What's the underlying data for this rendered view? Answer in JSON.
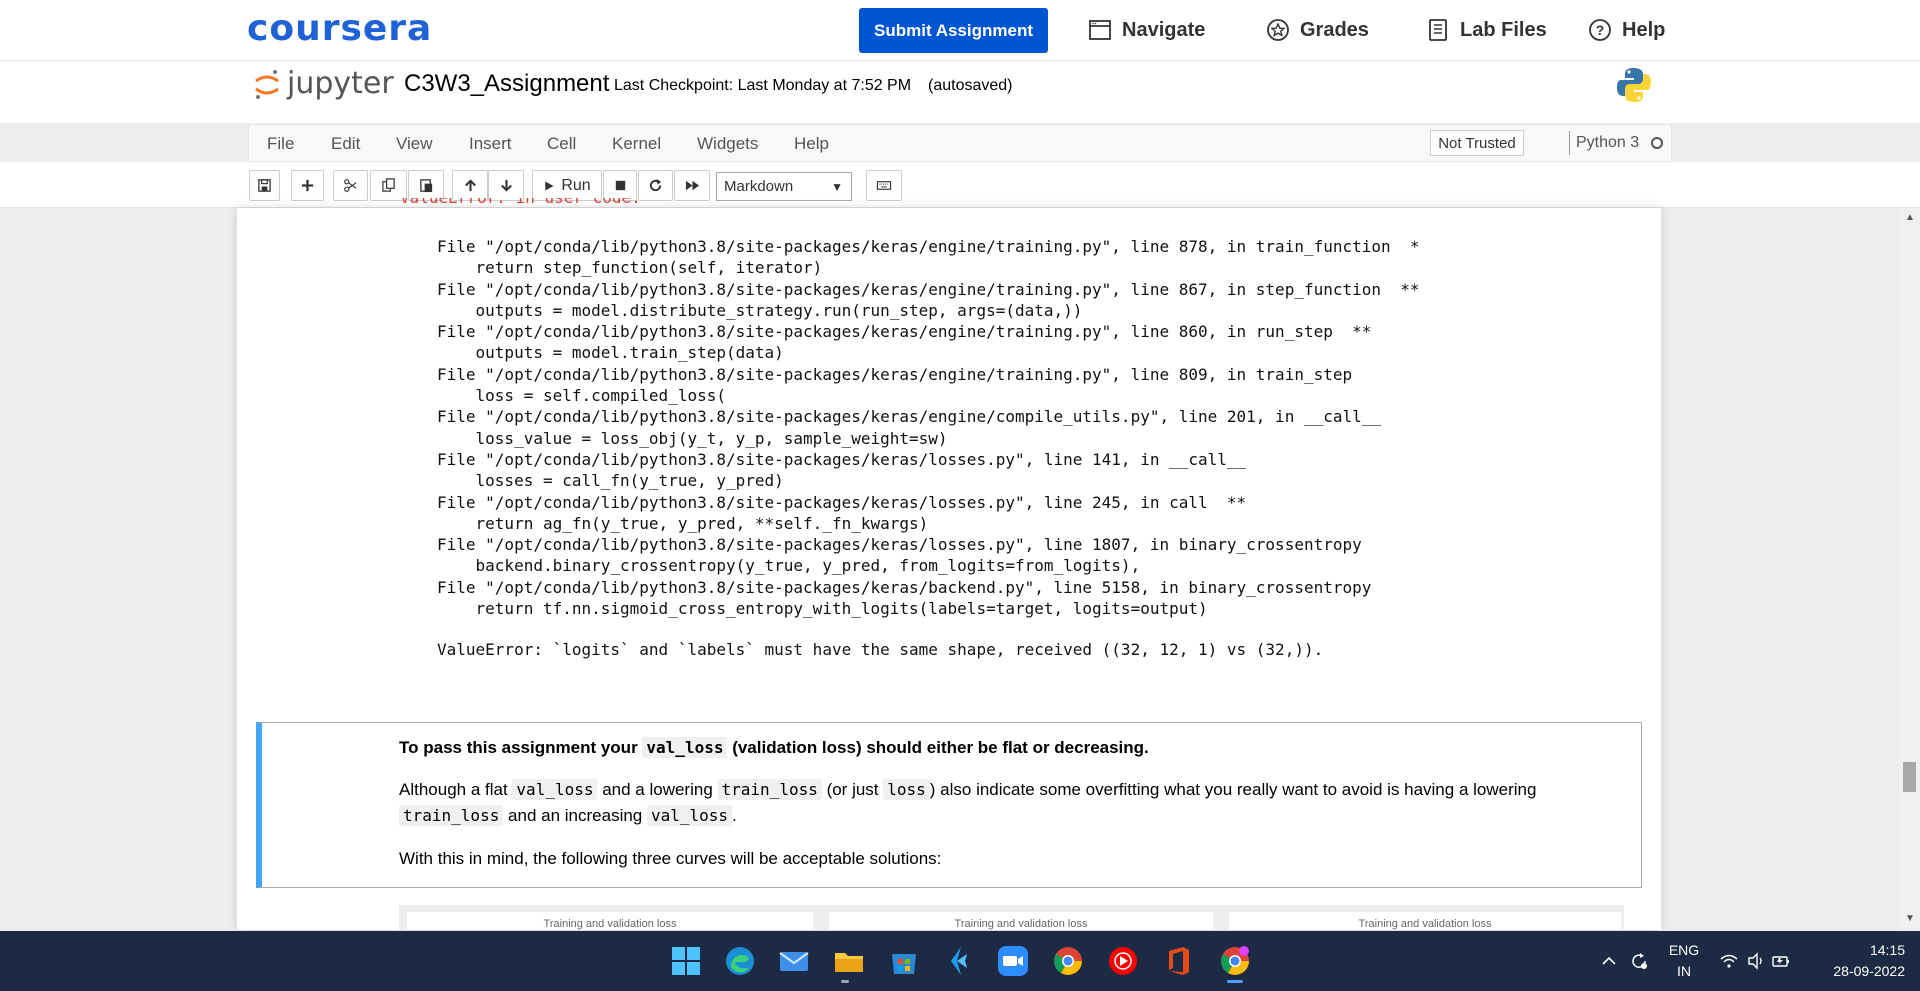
{
  "coursera": {
    "logo": "coursera",
    "submit_label": "Submit Assignment",
    "nav": [
      "Navigate",
      "Grades",
      "Lab Files",
      "Help"
    ]
  },
  "jupyter": {
    "logo_text": "jupyter",
    "notebook_title": "C3W3_Assignment",
    "checkpoint": "Last Checkpoint: Last Monday at 7:52 PM",
    "autosaved": "(autosaved)"
  },
  "menu": [
    "File",
    "Edit",
    "View",
    "Insert",
    "Cell",
    "Kernel",
    "Widgets",
    "Help"
  ],
  "trust_status": "Not Trusted",
  "kernel_name": "Python 3",
  "toolbar": {
    "run_label": "Run",
    "cell_type": "Markdown"
  },
  "output": {
    "error_top": "ValueError: in user code:",
    "trace": [
      "File \"/opt/conda/lib/python3.8/site-packages/keras/engine/training.py\", line 878, in train_function  *",
      "    return step_function(self, iterator)",
      "File \"/opt/conda/lib/python3.8/site-packages/keras/engine/training.py\", line 867, in step_function  **",
      "    outputs = model.distribute_strategy.run(run_step, args=(data,))",
      "File \"/opt/conda/lib/python3.8/site-packages/keras/engine/training.py\", line 860, in run_step  **",
      "    outputs = model.train_step(data)",
      "File \"/opt/conda/lib/python3.8/site-packages/keras/engine/training.py\", line 809, in train_step",
      "    loss = self.compiled_loss(",
      "File \"/opt/conda/lib/python3.8/site-packages/keras/engine/compile_utils.py\", line 201, in __call__",
      "    loss_value = loss_obj(y_t, y_p, sample_weight=sw)",
      "File \"/opt/conda/lib/python3.8/site-packages/keras/losses.py\", line 141, in __call__",
      "    losses = call_fn(y_true, y_pred)",
      "File \"/opt/conda/lib/python3.8/site-packages/keras/losses.py\", line 245, in call  **",
      "    return ag_fn(y_true, y_pred, **self._fn_kwargs)",
      "File \"/opt/conda/lib/python3.8/site-packages/keras/losses.py\", line 1807, in binary_crossentropy",
      "    backend.binary_crossentropy(y_true, y_pred, from_logits=from_logits),",
      "File \"/opt/conda/lib/python3.8/site-packages/keras/backend.py\", line 5158, in binary_crossentropy",
      "    return tf.nn.sigmoid_cross_entropy_with_logits(labels=target, logits=output)"
    ],
    "final_error": "ValueError: `logits` and `labels` must have the same shape, received ((32, 12, 1) vs (32,))."
  },
  "markdown": {
    "p1_a": "To pass this assignment your ",
    "p1_code": "val_loss",
    "p1_b": " (validation loss) should either be flat or decreasing.",
    "p2_a": "Although a flat ",
    "p2_code1": "val_loss",
    "p2_b": " and a lowering ",
    "p2_code2": "train_loss",
    "p2_c": " (or just ",
    "p2_code3": "loss",
    "p2_d": ") also indicate some overfitting what you really want to avoid is having a lowering",
    "p2_code4": "train_loss",
    "p2_e": " and an increasing ",
    "p2_code5": "val_loss",
    "p2_f": ".",
    "p3": "With this in mind, the following three curves will be acceptable solutions:",
    "image_captions": [
      "Training and validation loss",
      "Training and validation loss",
      "Training and validation loss"
    ]
  },
  "taskbar": {
    "lang_top": "ENG",
    "lang_bottom": "IN",
    "time": "14:15",
    "date": "28-09-2022"
  },
  "colors": {
    "coursera_blue": "#0056d2",
    "jupyter_orange": "#f37726",
    "md_cell_accent": "#42a5f5",
    "error_red": "#d4453d",
    "taskbar": "#1c2a44"
  }
}
